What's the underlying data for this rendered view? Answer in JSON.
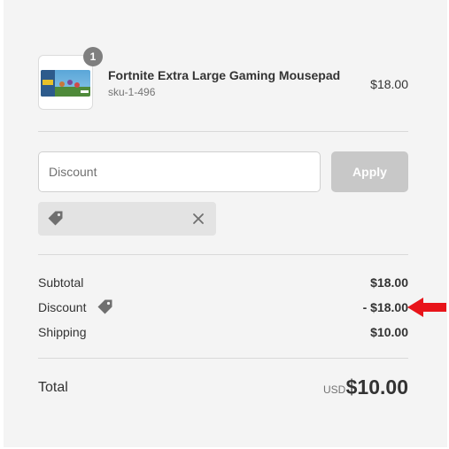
{
  "product": {
    "quantity": "1",
    "name": "Fortnite Extra Large Gaming Mousepad",
    "sku": "sku-1-496",
    "price": "$18.00"
  },
  "discount_form": {
    "placeholder": "Discount",
    "apply_label": "Apply"
  },
  "summary": {
    "subtotal_label": "Subtotal",
    "subtotal_value": "$18.00",
    "discount_label": "Discount",
    "discount_value": "- $18.00",
    "shipping_label": "Shipping",
    "shipping_value": "$10.00",
    "total_label": "Total",
    "currency": "USD",
    "total_value": "$10.00"
  },
  "colors": {
    "panel_bg": "#f4f4f4",
    "apply_disabled": "#c8c8c8",
    "annotation_arrow": "#e8141a"
  },
  "icons": {
    "tag": "tag-icon",
    "close": "close-icon",
    "arrow": "red-arrow-icon"
  }
}
